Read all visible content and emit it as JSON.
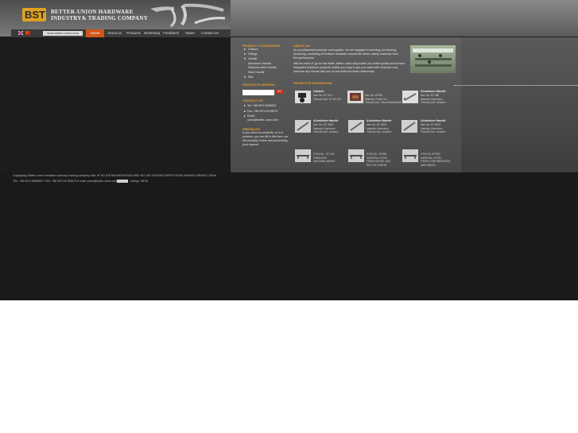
{
  "header": {
    "company_line1": "BETTER-UNION HARDWARE",
    "company_line2": "INDUSTRY& TRADING COMPANY",
    "logo_text": "BST",
    "url": "www.better-union.com"
  },
  "nav": {
    "items": [
      "Home",
      "About us",
      "Products",
      "Workshop",
      "Feedback",
      "News",
      "Contact us"
    ]
  },
  "sidebar": {
    "categories_title": "PRODUCT CATEGORIES",
    "categories": [
      "Castors",
      "Fittings",
      "Handle",
      "Aluminium Handle",
      "Stainless steel Handle",
      "Steel Handle",
      "Slat"
    ],
    "search_title": "PRODUCTS SEARCH",
    "search_go": "GO",
    "contact_title": "CONTACT US",
    "contact_tel": "Tel: +86 0574 8288307",
    "contact_fax": "Fax: +86 0574 8728079",
    "contact_email_label": "Email:",
    "contact_email": "union@better-union.com",
    "feedback_title": "FEEDBACK",
    "feedback_text": [
      "If you need our products, or in a",
      "problem, you can fill in this form, we",
      "will promptly review and processing",
      "your request."
    ]
  },
  "about": {
    "title": "ABOUT US",
    "text": [
      "As a professional producer and supplier, we are engaged in sourcing, purchasing,",
      "producing, marketing of furniture hardware around the world, mainly customer from",
      "Europe/America.",
      "with the mind of 'go for the better, Better union will provide you better quality and service,",
      "integrated hardware products enable you easy to get your want with minimum cost,",
      "welcome any friends with join us and build business relationship."
    ]
  },
  "showroom": {
    "title": "PRODUCTS SHOWROOM",
    "products": [
      {
        "name": "Castors",
        "lines": [
          "Item No: BT-R4-4",
          "Finish&Color: BT-R4-0%"
        ]
      },
      {
        "name": "",
        "lines": [
          "Item No: BT824",
          "Material: Plastic Nw",
          "Finish&Color: Silver/White/Black"
        ]
      },
      {
        "name": "Aluminium Handle",
        "lines": [
          "Item No: BT-388",
          "Material: Aluminium",
          "Finish&Color: Anodize"
        ]
      },
      {
        "name": "Aluminium Handle",
        "lines": [
          "Item No: BT-9008",
          "Material: Aluminium",
          "Finish&Color: Anodize"
        ]
      },
      {
        "name": "Aluminium Handle",
        "lines": [
          "Item No: BT-9008",
          "Material: Aluminium",
          "Finish&Color: Anodize"
        ]
      },
      {
        "name": "Aluminium Handle",
        "lines": [
          "Item No: BT-9003",
          "Material: Aluminium",
          "Finish&Color: Anodize"
        ]
      },
      {
        "name": "",
        "lines": [
          "ITEM NO.: BT-106",
          "FINISH:MIX",
          "MATERIAL:BRASS"
        ]
      },
      {
        "name": "",
        "lines": [
          "ITEM NO.: BT9S1",
          "MATERIAL:STEEL",
          "FINISH:NICKEL AND",
          "RED OR CHROM"
        ]
      },
      {
        "name": "",
        "lines": [
          "ITEM NO.:BT9S2",
          "MATERIAL:STEEL",
          "FINISH:CHROME/NICKEL",
          "AND BRUSH"
        ]
      }
    ]
  },
  "footer": {
    "line1": "Copyright(c) Better union hardware industry& trading company    Add: 9F NO.318 NINGHSAN BUILDING NO.199 JUNTANG NORTH ROAD NINGBO NINGBO CHINA",
    "line2": "TEL: +86 0574 82883077   FAX: +86 0574 87283079   E-mail: union@better-union.com",
    "line2_tail": "Design: WF36"
  },
  "colors": {
    "accent": "#e8a030",
    "home": "#d45418",
    "go": "#c0301a"
  }
}
